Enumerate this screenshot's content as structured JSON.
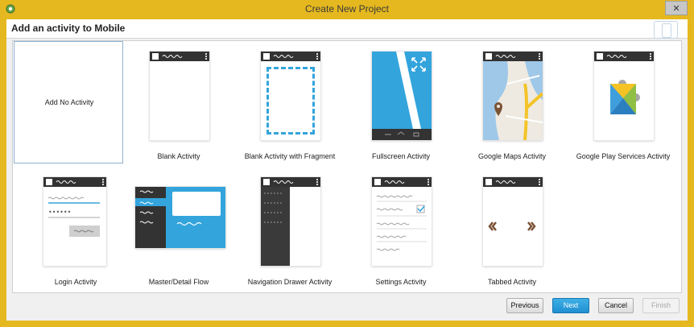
{
  "window": {
    "title": "Create New Project",
    "close_label": "✕"
  },
  "header": {
    "title": "Add an activity to Mobile"
  },
  "activities": [
    {
      "label": "Add No Activity",
      "icon": "no-activity-icon"
    },
    {
      "label": "Blank Activity",
      "icon": "blank-activity-icon"
    },
    {
      "label": "Blank Activity with Fragment",
      "icon": "blank-fragment-icon"
    },
    {
      "label": "Fullscreen Activity",
      "icon": "fullscreen-icon"
    },
    {
      "label": "Google Maps Activity",
      "icon": "maps-icon"
    },
    {
      "label": "Google Play Services Activity",
      "icon": "play-services-icon"
    },
    {
      "label": "Login Activity",
      "icon": "login-icon"
    },
    {
      "label": "Master/Detail Flow",
      "icon": "master-detail-icon"
    },
    {
      "label": "Navigation Drawer Activity",
      "icon": "nav-drawer-icon"
    },
    {
      "label": "Settings Activity",
      "icon": "settings-icon"
    },
    {
      "label": "Tabbed Activity",
      "icon": "tabbed-icon"
    }
  ],
  "buttons": {
    "previous": "Previous",
    "next": "Next",
    "cancel": "Cancel",
    "finish": "Finish"
  },
  "colors": {
    "frame": "#e5b81f",
    "accent": "#33a4dc",
    "bar": "#333333"
  }
}
